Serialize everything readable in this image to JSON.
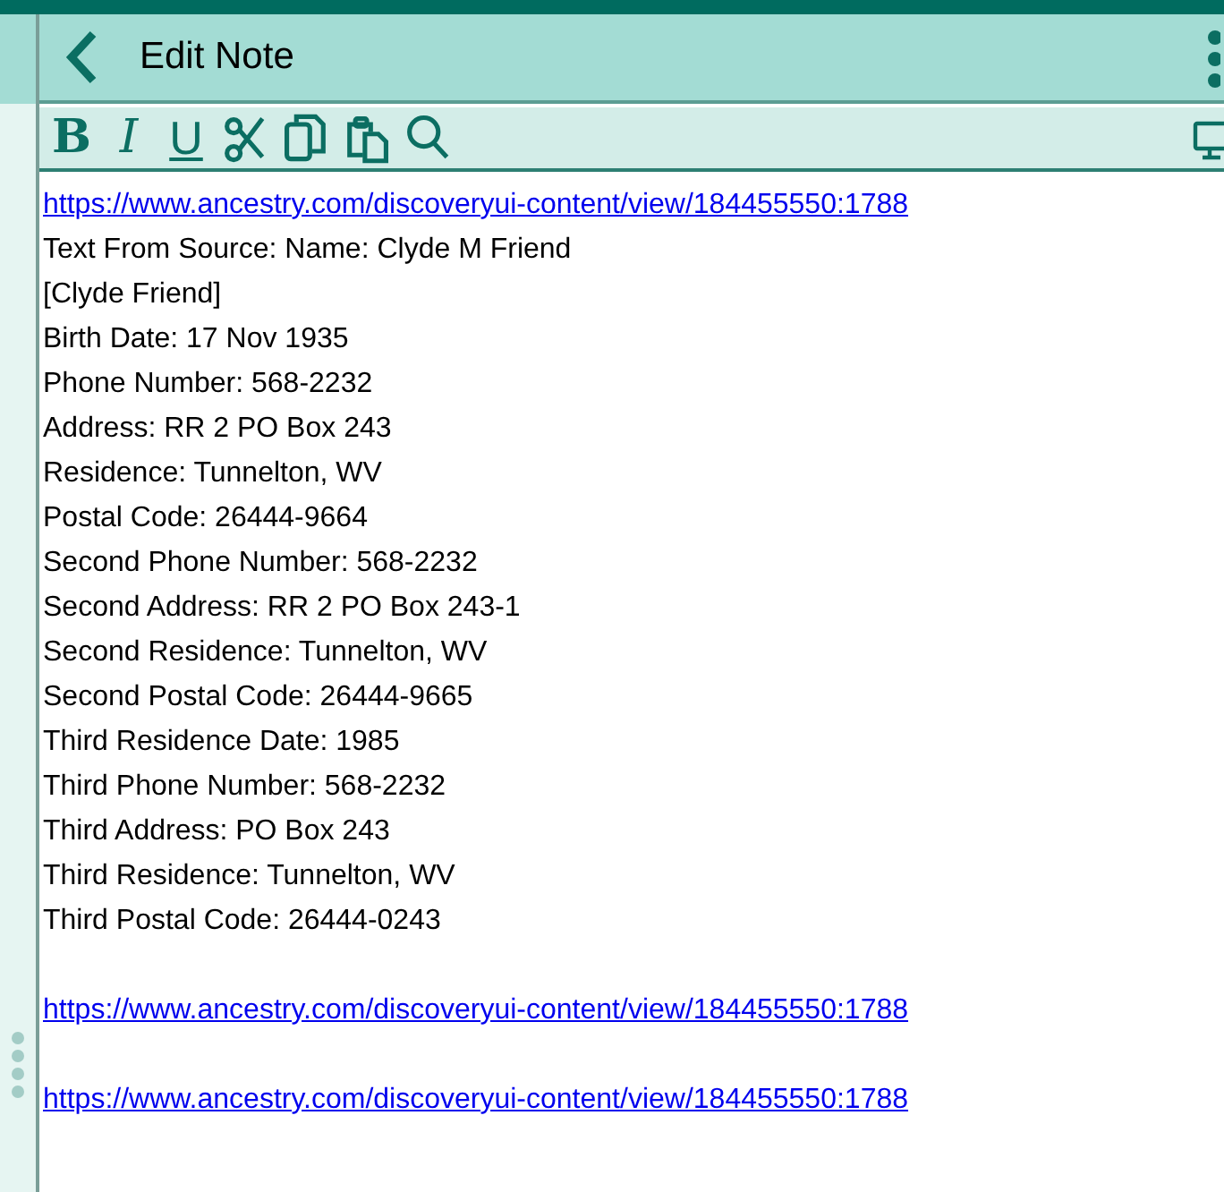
{
  "header": {
    "title": "Edit Note"
  },
  "toolbar": [
    {
      "kind": "bold",
      "label": "B"
    },
    {
      "kind": "italic",
      "label": "I"
    },
    {
      "kind": "underline",
      "label": "U"
    },
    {
      "kind": "cut"
    },
    {
      "kind": "copy"
    },
    {
      "kind": "paste"
    },
    {
      "kind": "search"
    }
  ],
  "note": [
    {
      "kind": "link",
      "text": "https://www.ancestry.com/discoveryui-content/view/184455550:1788"
    },
    {
      "kind": "text",
      "text": "Text From Source: Name: Clyde M Friend"
    },
    {
      "kind": "text",
      "text": "[Clyde Friend]"
    },
    {
      "kind": "text",
      "text": "Birth Date: 17 Nov 1935"
    },
    {
      "kind": "text",
      "text": "Phone Number: 568-2232"
    },
    {
      "kind": "text",
      "text": "Address: RR 2 PO Box 243"
    },
    {
      "kind": "text",
      "text": "Residence: Tunnelton, WV"
    },
    {
      "kind": "text",
      "text": "Postal Code: 26444-9664"
    },
    {
      "kind": "text",
      "text": "Second Phone Number: 568-2232"
    },
    {
      "kind": "text",
      "text": "Second Address: RR 2 PO Box 243-1"
    },
    {
      "kind": "text",
      "text": "Second Residence: Tunnelton, WV"
    },
    {
      "kind": "text",
      "text": "Second Postal Code: 26444-9665"
    },
    {
      "kind": "text",
      "text": "Third Residence Date: 1985"
    },
    {
      "kind": "text",
      "text": "Third Phone Number: 568-2232"
    },
    {
      "kind": "text",
      "text": "Third Address: PO Box 243"
    },
    {
      "kind": "text",
      "text": "Third Residence: Tunnelton, WV"
    },
    {
      "kind": "text",
      "text": "Third Postal Code: 26444-0243"
    },
    {
      "kind": "blank"
    },
    {
      "kind": "link",
      "text": "https://www.ancestry.com/discoveryui-content/view/184455550:1788"
    },
    {
      "kind": "blank"
    },
    {
      "kind": "link",
      "text": "https://www.ancestry.com/discoveryui-content/view/184455550:1788"
    }
  ]
}
